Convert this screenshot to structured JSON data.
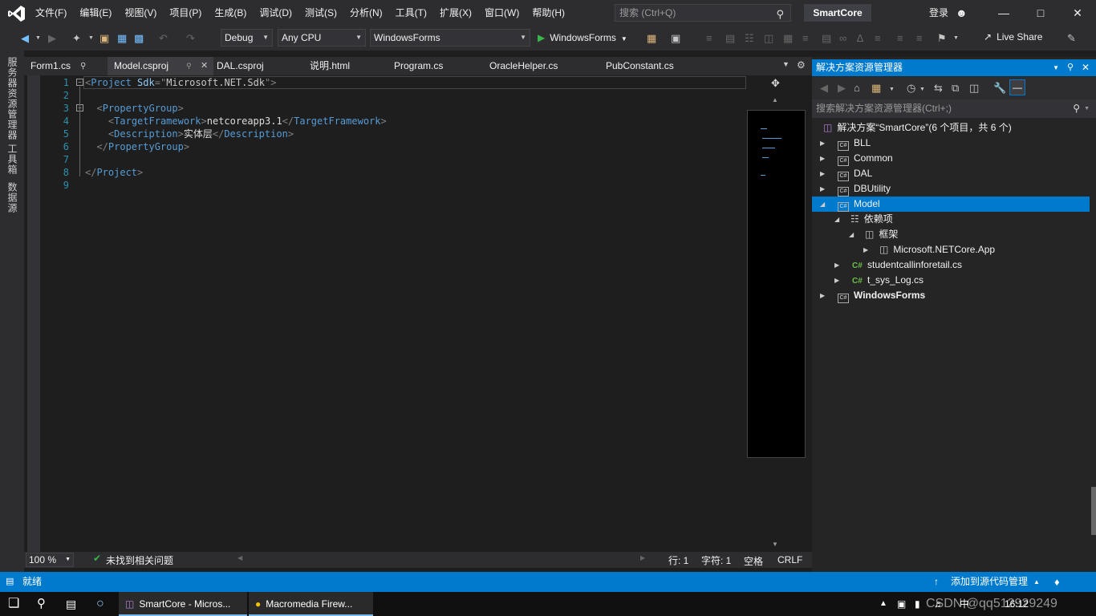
{
  "menu": {
    "items": [
      "文件(F)",
      "编辑(E)",
      "视图(V)",
      "项目(P)",
      "生成(B)",
      "调试(D)",
      "测试(S)",
      "分析(N)",
      "工具(T)",
      "扩展(X)",
      "窗口(W)",
      "帮助(H)"
    ],
    "search_placeholder": "搜索 (Ctrl+Q)",
    "solution_name": "SmartCore",
    "login": "登录"
  },
  "toolbar": {
    "config": "Debug",
    "platform": "Any CPU",
    "startup_project": "WindowsForms",
    "run_label": "WindowsForms",
    "live_share": "Live Share"
  },
  "left_strip": [
    "服务器资源管理器",
    "工具箱",
    "数据源"
  ],
  "tabs": [
    {
      "label": "Form1.cs"
    },
    {
      "label": "Model.csproj"
    },
    {
      "label": "DAL.csproj"
    },
    {
      "label": "说明.html"
    },
    {
      "label": "Program.cs"
    },
    {
      "label": "OracleHelper.cs"
    },
    {
      "label": "PubConstant.cs"
    }
  ],
  "editor": {
    "line_numbers": [
      "1",
      "2",
      "3",
      "4",
      "5",
      "6",
      "7",
      "8",
      "9"
    ],
    "lines": [
      {
        "indent": "",
        "open": "<",
        "tag": "Project",
        "sp": " ",
        "attr": "Sdk",
        "eq": "=",
        "q1": "\"",
        "val": "Microsoft.NET.Sdk",
        "q2": "\"",
        "close": ">"
      },
      {},
      {
        "indent": "  ",
        "open": "<",
        "tag": "PropertyGroup",
        "close": ">"
      },
      {
        "indent": "    ",
        "open": "<",
        "tag": "TargetFramework",
        "close": ">",
        "text": "netcoreapp3.1",
        "open2": "</",
        "tag2": "TargetFramework",
        "close2": ">"
      },
      {
        "indent": "    ",
        "open": "<",
        "tag": "Description",
        "close": ">",
        "text": "实体层",
        "open2": "</",
        "tag2": "Description",
        "close2": ">"
      },
      {
        "indent": "  ",
        "open": "</",
        "tag": "PropertyGroup",
        "close": ">"
      },
      {},
      {
        "indent": "",
        "open": "</",
        "tag": "Project",
        "close": ">"
      },
      {}
    ]
  },
  "editor_status": {
    "zoom": "100 %",
    "issues": "未找到相关问题",
    "line": "行: 1",
    "col": "字符: 1",
    "spaces": "空格",
    "eol": "CRLF"
  },
  "solution_explorer": {
    "title": "解决方案资源管理器",
    "search_placeholder": "搜索解决方案资源管理器(Ctrl+;)",
    "root": "解决方案“SmartCore”(6 个项目，共 6 个)",
    "items": [
      "BLL",
      "Common",
      "DAL",
      "DBUtility",
      "Model",
      "依赖项",
      "框架",
      "Microsoft.NETCore.App",
      "studentcallinforetail.cs",
      "t_sys_Log.cs",
      "WindowsForms"
    ]
  },
  "statusbar": {
    "ready": "就绪",
    "source_control": "添加到源代码管理"
  },
  "taskbar": {
    "vs_label": "SmartCore - Micros...",
    "fw_label": "Macromedia Firew...",
    "time": "16:12",
    "watermark": "CSDN @qq512929249"
  },
  "colors": {
    "accent": "#007acc",
    "chrome": "#2d2d30",
    "editor_bg": "#1e1e1e",
    "xml_tag": "#569cd6",
    "xml_attr": "#92caf4"
  }
}
